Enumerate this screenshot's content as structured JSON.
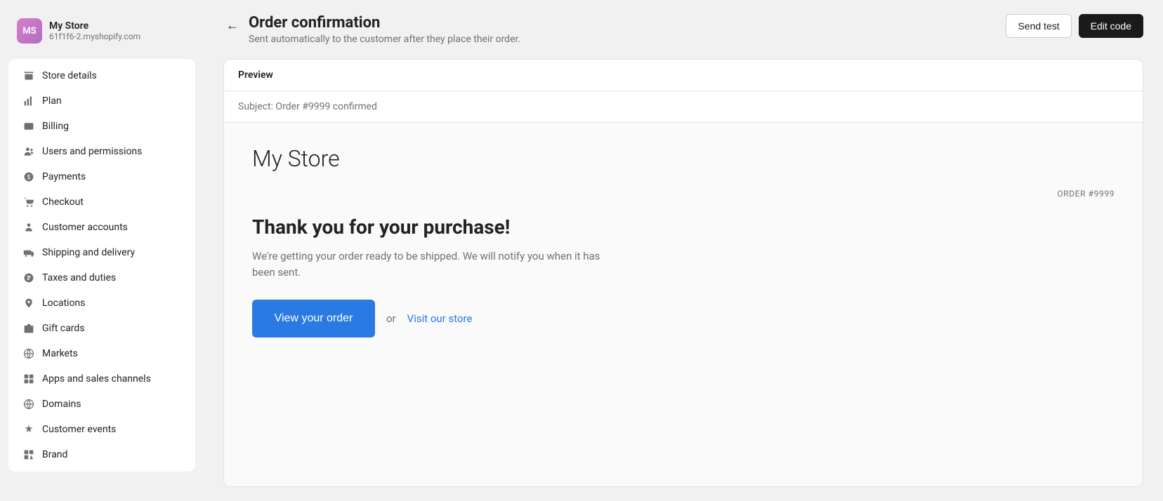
{
  "sidebar": {
    "store": {
      "initials": "MS",
      "name": "My Store",
      "url": "61f1f6-2.myshopify.com"
    },
    "items": [
      {
        "id": "store-details",
        "label": "Store details",
        "icon": "🏪"
      },
      {
        "id": "plan",
        "label": "Plan",
        "icon": "📊"
      },
      {
        "id": "billing",
        "label": "Billing",
        "icon": "💳"
      },
      {
        "id": "users-permissions",
        "label": "Users and permissions",
        "icon": "👥"
      },
      {
        "id": "payments",
        "label": "Payments",
        "icon": "💸"
      },
      {
        "id": "checkout",
        "label": "Checkout",
        "icon": "🛒"
      },
      {
        "id": "customer-accounts",
        "label": "Customer accounts",
        "icon": "👤"
      },
      {
        "id": "shipping-delivery",
        "label": "Shipping and delivery",
        "icon": "🚚"
      },
      {
        "id": "taxes-duties",
        "label": "Taxes and duties",
        "icon": "🏷️"
      },
      {
        "id": "locations",
        "label": "Locations",
        "icon": "📍"
      },
      {
        "id": "gift-cards",
        "label": "Gift cards",
        "icon": "🎁"
      },
      {
        "id": "markets",
        "label": "Markets",
        "icon": "🌐"
      },
      {
        "id": "apps-sales-channels",
        "label": "Apps and sales channels",
        "icon": "⚙️"
      },
      {
        "id": "domains",
        "label": "Domains",
        "icon": "🌍"
      },
      {
        "id": "customer-events",
        "label": "Customer events",
        "icon": "✨"
      },
      {
        "id": "brand",
        "label": "Brand",
        "icon": "🎨"
      }
    ]
  },
  "header": {
    "title": "Order confirmation",
    "subtitle": "Sent automatically to the customer after they place their order.",
    "send_test_label": "Send test",
    "edit_code_label": "Edit code"
  },
  "preview": {
    "label": "Preview",
    "subject": "Subject: Order #9999 confirmed",
    "email": {
      "store_name": "My Store",
      "order_number": "ORDER #9999",
      "thank_you": "Thank you for your purchase!",
      "description": "We're getting your order ready to be shipped. We will notify you when it has been sent.",
      "view_order_label": "View your order",
      "or_text": "or",
      "visit_store_label": "Visit our store"
    }
  }
}
